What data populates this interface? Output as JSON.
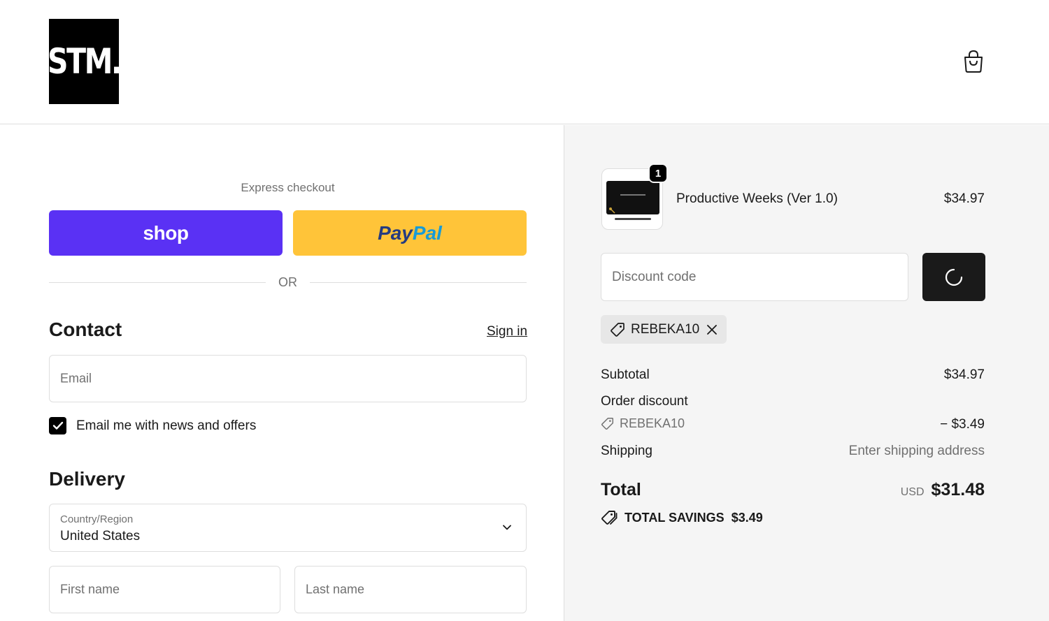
{
  "header": {
    "logo_text": "STM.",
    "cart_icon": "shopping-bag-icon"
  },
  "express": {
    "label": "Express checkout",
    "shop_label": "shop",
    "paypal_pay": "Pay",
    "paypal_pal": "Pal",
    "or_text": "OR"
  },
  "contact": {
    "title": "Contact",
    "sign_in": "Sign in",
    "email_placeholder": "Email",
    "newsletter_label": "Email me with news and offers",
    "newsletter_checked": true
  },
  "delivery": {
    "title": "Delivery",
    "country_label": "Country/Region",
    "country_value": "United States",
    "first_name_placeholder": "First name",
    "last_name_placeholder": "Last name"
  },
  "summary": {
    "item": {
      "name": "Productive Weeks (Ver 1.0)",
      "price": "$34.97",
      "quantity": "1"
    },
    "discount_placeholder": "Discount code",
    "applied_code": "REBEKA10",
    "subtotal_label": "Subtotal",
    "subtotal_value": "$34.97",
    "order_discount_label": "Order discount",
    "discount_code_line": "REBEKA10",
    "discount_value": "− $3.49",
    "shipping_label": "Shipping",
    "shipping_value": "Enter shipping address",
    "total_label": "Total",
    "currency": "USD",
    "total_value": "$31.48",
    "savings_label": "TOTAL SAVINGS",
    "savings_value": "$3.49"
  },
  "colors": {
    "shop_purple": "#5a31f4",
    "paypal_yellow": "#ffc439",
    "dark": "#1a1a1a",
    "summary_bg": "#f5f5f5"
  }
}
